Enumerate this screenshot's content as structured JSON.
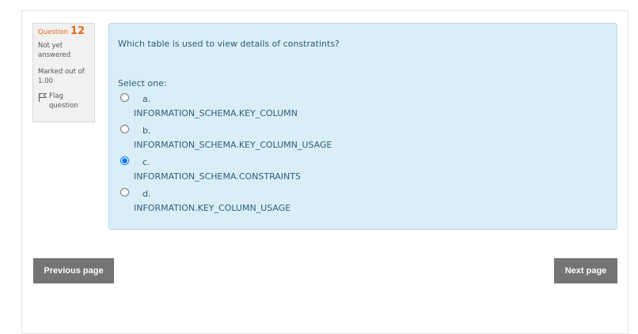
{
  "question": {
    "number_label": "Question",
    "number": "12",
    "state": "Not yet answered",
    "grade": "Marked out of 1.00",
    "flag_label": "Flag question",
    "text": "Which table is used to view details of constratints?",
    "prompt": "Select one:",
    "selected_index": 2,
    "answers": [
      {
        "letter": "a.",
        "text": "INFORMATION_SCHEMA.KEY_COLUMN"
      },
      {
        "letter": "b.",
        "text": "INFORMATION_SCHEMA.KEY_COLUMN_USAGE"
      },
      {
        "letter": "c.",
        "text": "INFORMATION_SCHEMA.CONSTRAINTS"
      },
      {
        "letter": "d.",
        "text": "INFORMATION.KEY_COLUMN_USAGE"
      }
    ]
  },
  "nav": {
    "previous_label": "Previous page",
    "next_label": "Next page"
  },
  "icons": {
    "flag": "flag-icon"
  },
  "colors": {
    "accent_orange": "#e66a1a",
    "content_bg": "#dbeef7",
    "content_text": "#2b5f7a",
    "button_bg": "#747474"
  }
}
